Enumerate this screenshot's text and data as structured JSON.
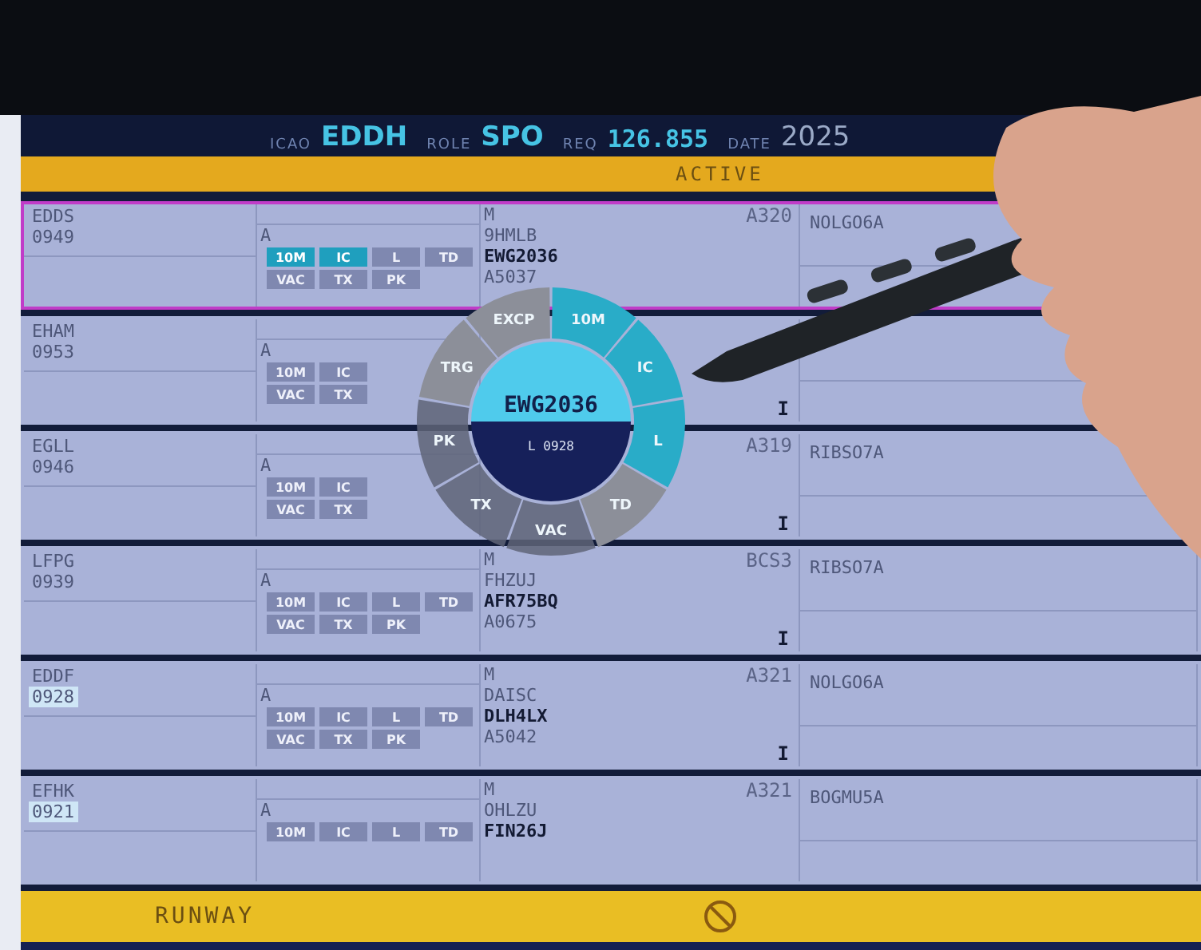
{
  "header": {
    "fields": [
      {
        "label": "ICAO",
        "value": "EDDH",
        "kind": "large"
      },
      {
        "label": "ROLE",
        "value": "SPO",
        "kind": "large"
      },
      {
        "label": "REQ",
        "value": "126.855",
        "kind": "mono"
      },
      {
        "label": "DATE",
        "value": "2025",
        "kind": "plain"
      }
    ]
  },
  "active_bar": {
    "title": "ACTIVE"
  },
  "strips": [
    {
      "icao": "EDDS",
      "time": "0949",
      "time_marked": false,
      "selected": true,
      "mode": "A",
      "buttons_top": [
        {
          "label": "10M",
          "active": true
        },
        {
          "label": "IC",
          "active": true
        },
        {
          "label": "L",
          "active": false
        },
        {
          "label": "TD",
          "active": false
        }
      ],
      "buttons_bottom": [
        {
          "label": "VAC",
          "active": false
        },
        {
          "label": "TX",
          "active": false
        },
        {
          "label": "PK",
          "active": false
        }
      ],
      "flight": [
        "M",
        "9HMLB",
        "EWG2036",
        "A5037"
      ],
      "type": "A320",
      "route": "NOLGO6A"
    },
    {
      "icao": "EHAM",
      "time": "0953",
      "time_marked": false,
      "selected": false,
      "mode": "A",
      "buttons_top": [
        {
          "label": "10M",
          "active": false
        },
        {
          "label": "IC",
          "active": false
        }
      ],
      "buttons_bottom": [
        {
          "label": "VAC",
          "active": false
        },
        {
          "label": "TX",
          "active": false
        }
      ],
      "rule": "I"
    },
    {
      "icao": "EGLL",
      "time": "0946",
      "time_marked": false,
      "selected": false,
      "mode": "A",
      "buttons_top": [
        {
          "label": "10M",
          "active": false
        },
        {
          "label": "IC",
          "active": false
        }
      ],
      "buttons_bottom": [
        {
          "label": "VAC",
          "active": false
        },
        {
          "label": "TX",
          "active": false
        }
      ],
      "type": "A319",
      "route": "RIBSO7A",
      "rule": "I"
    },
    {
      "icao": "LFPG",
      "time": "0939",
      "time_marked": false,
      "selected": false,
      "mode": "A",
      "buttons_top": [
        {
          "label": "10M",
          "active": false
        },
        {
          "label": "IC",
          "active": false
        },
        {
          "label": "L",
          "active": false
        },
        {
          "label": "TD",
          "active": false
        }
      ],
      "buttons_bottom": [
        {
          "label": "VAC",
          "active": false
        },
        {
          "label": "TX",
          "active": false
        },
        {
          "label": "PK",
          "active": false
        }
      ],
      "flight": [
        "M",
        "FHZUJ",
        "AFR75BQ",
        "A0675"
      ],
      "type": "BCS3",
      "route": "RIBSO7A",
      "rule": "I"
    },
    {
      "icao": "EDDF",
      "time": "0928",
      "time_marked": true,
      "selected": false,
      "mode": "A",
      "buttons_top": [
        {
          "label": "10M",
          "active": false
        },
        {
          "label": "IC",
          "active": false
        },
        {
          "label": "L",
          "active": false
        },
        {
          "label": "TD",
          "active": false
        }
      ],
      "buttons_bottom": [
        {
          "label": "VAC",
          "active": false
        },
        {
          "label": "TX",
          "active": false
        },
        {
          "label": "PK",
          "active": false
        }
      ],
      "flight": [
        "M",
        "DAISC",
        "DLH4LX",
        "A5042"
      ],
      "type": "A321",
      "route": "NOLGO6A",
      "rule": "I"
    },
    {
      "icao": "EFHK",
      "time": "0921",
      "time_marked": true,
      "selected": false,
      "mode": "A",
      "buttons_top": [
        {
          "label": "10M",
          "active": false
        },
        {
          "label": "IC",
          "active": false
        },
        {
          "label": "L",
          "active": false
        },
        {
          "label": "TD",
          "active": false
        }
      ],
      "flight": [
        "M",
        "OHLZU",
        "FIN26J"
      ],
      "type": "A321",
      "route": "BOGMU5A"
    }
  ],
  "radial_menu": {
    "callsign": "EWG2036",
    "detail": "L 0928",
    "segments": [
      {
        "label": "TRG",
        "active": false
      },
      {
        "label": "EXCP",
        "active": false
      },
      {
        "label": "10M",
        "active": true
      },
      {
        "label": "IC",
        "active": true
      },
      {
        "label": "L",
        "active": true
      },
      {
        "label": "TD",
        "active": false
      },
      {
        "label": "VAC",
        "active": false
      },
      {
        "label": "TX",
        "active": false
      },
      {
        "label": "PK",
        "active": false
      }
    ]
  },
  "runway_bar": {
    "title": "RUNWAY"
  }
}
